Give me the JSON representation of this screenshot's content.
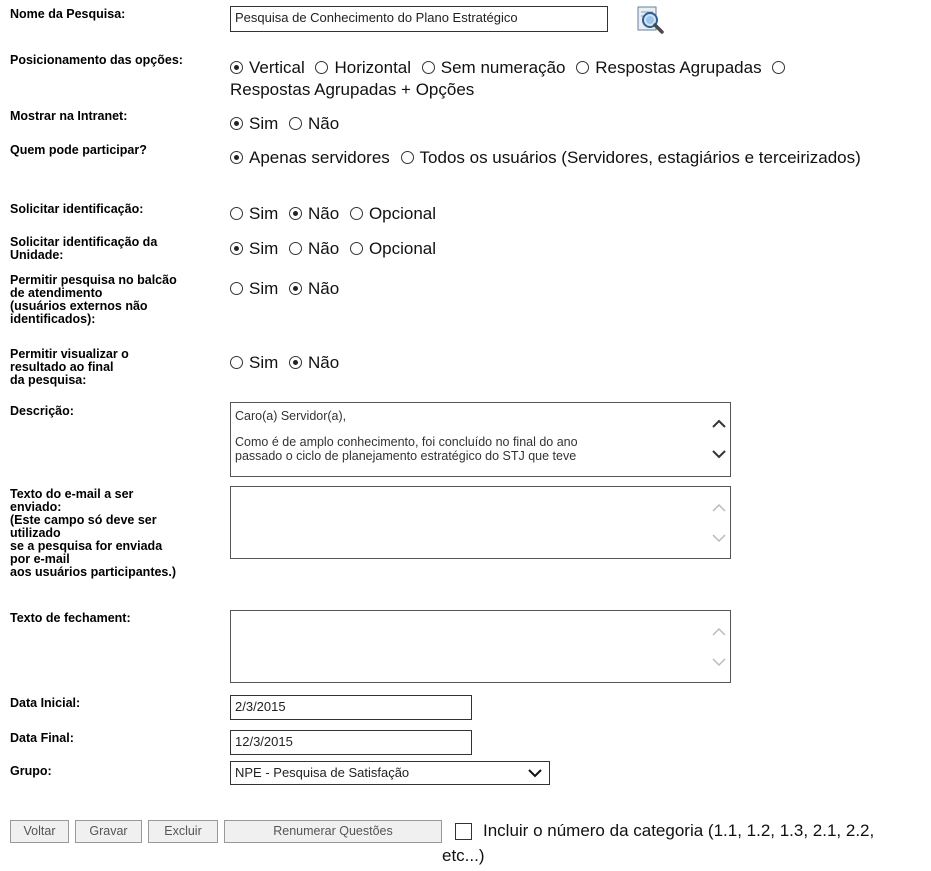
{
  "fields": {
    "nome": {
      "label": "Nome da Pesquisa:",
      "value": "Pesquisa de Conhecimento do Plano Estratégico",
      "icon": "search-document-icon"
    },
    "posicionamento": {
      "label": "Posicionamento das opções:",
      "options": [
        "Vertical",
        "Horizontal",
        "Sem numeração",
        "Respostas Agrupadas",
        "Respostas Agrupadas + Opções"
      ],
      "selected": "Vertical"
    },
    "intranet": {
      "label": "Mostrar na Intranet:",
      "options": [
        "Sim",
        "Não"
      ],
      "selected": "Sim"
    },
    "participar": {
      "label": "Quem pode participar?",
      "options": [
        "Apenas servidores",
        "Todos os usuários (Servidores, estagiários e terceirizados)"
      ],
      "selected": "Apenas servidores"
    },
    "identificacao": {
      "label": "Solicitar identificação:",
      "options": [
        "Sim",
        "Não",
        "Opcional"
      ],
      "selected": "Não"
    },
    "identificacao_unidade": {
      "label_lines": [
        "Solicitar identificação da",
        "Unidade:"
      ],
      "options": [
        "Sim",
        "Não",
        "Opcional"
      ],
      "selected": "Sim"
    },
    "balcao": {
      "label_lines": [
        "Permitir pesquisa no balcão",
        "de atendimento",
        "(usuários externos não",
        "identificados):"
      ],
      "options": [
        "Sim",
        "Não"
      ],
      "selected": "Não"
    },
    "resultado": {
      "label_lines": [
        "Permitir visualizar o",
        "resultado ao final",
        "da pesquisa:"
      ],
      "options": [
        "Sim",
        "Não"
      ],
      "selected": "Não"
    },
    "descricao": {
      "label": "Descrição:",
      "lines": [
        "Caro(a) Servidor(a),",
        "Como é de amplo conhecimento, foi concluído no final do ano",
        "passado o ciclo de planejamento estratégico do STJ que teve"
      ]
    },
    "email": {
      "label_lines": [
        "Texto do e-mail a ser",
        "enviado:",
        "(Este campo só deve ser",
        "utilizado",
        "se a pesquisa for enviada",
        "por e-mail",
        "aos usuários participantes.)"
      ],
      "value": ""
    },
    "fechamento": {
      "label": "Texto de fechament:",
      "value": ""
    },
    "data_inicial": {
      "label": "Data Inicial:",
      "value": "2/3/2015"
    },
    "data_final": {
      "label": "Data Final:",
      "value": "12/3/2015"
    },
    "grupo": {
      "label": "Grupo:",
      "selected": "NPE - Pesquisa de Satisfação"
    }
  },
  "buttons": {
    "voltar": "Voltar",
    "gravar": "Gravar",
    "excluir": "Excluir",
    "renumerar": "Renumerar Questões"
  },
  "incluir": {
    "label_line1": "Incluir o número da categoria (1.1, 1.2, 1.3, 2.1, 2.2,",
    "label_line2": "etc...)",
    "checked": false
  }
}
